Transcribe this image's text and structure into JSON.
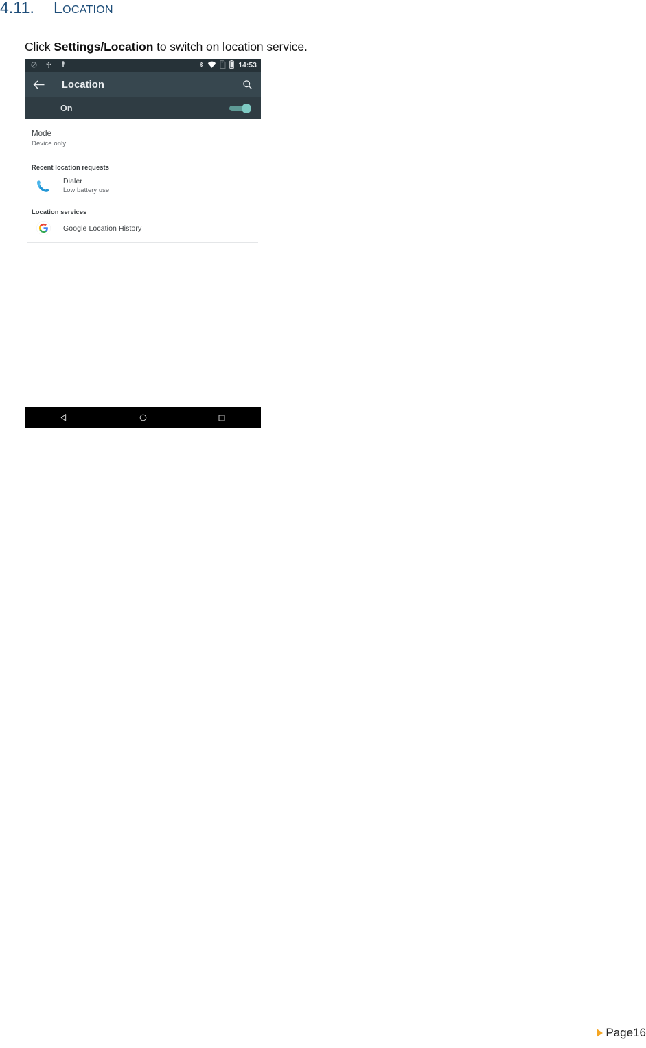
{
  "document": {
    "heading_number": "4.11.",
    "heading_title": "Location",
    "paragraph_prefix": "Click ",
    "paragraph_bold": "Settings/Location",
    "paragraph_suffix": " to switch on location service.",
    "footer_page": "Page16",
    "heading_color": "#1F4E79",
    "footer_bullet_color": "#F5A623"
  },
  "screenshot": {
    "status_bar": {
      "left_icons": [
        "sync-disabled-icon",
        "usb-icon",
        "usb-plug-icon"
      ],
      "right_icons": [
        "bluetooth-icon",
        "wifi-icon",
        "sd-card-icon",
        "battery-icon"
      ],
      "time": "14:53",
      "background": "#263238"
    },
    "action_bar": {
      "back_icon": "arrow-back-icon",
      "title": "Location",
      "search_icon": "search-icon",
      "background": "#37474f"
    },
    "master_switch": {
      "label": "On",
      "state": "on",
      "track_color": "#5e9a95",
      "knob_color": "#7fcbc4"
    },
    "mode_row": {
      "title": "Mode",
      "subtitle": "Device only"
    },
    "recent_requests": {
      "section_title": "Recent location requests",
      "items": [
        {
          "icon": "phone-dialer-icon",
          "title": "Dialer",
          "subtitle": "Low battery use"
        }
      ]
    },
    "location_services": {
      "section_title": "Location services",
      "items": [
        {
          "icon": "google-g-icon",
          "title": "Google Location History"
        }
      ]
    },
    "nav_bar": {
      "back_label": "back-nav",
      "home_label": "home-nav",
      "recents_label": "recents-nav"
    }
  }
}
